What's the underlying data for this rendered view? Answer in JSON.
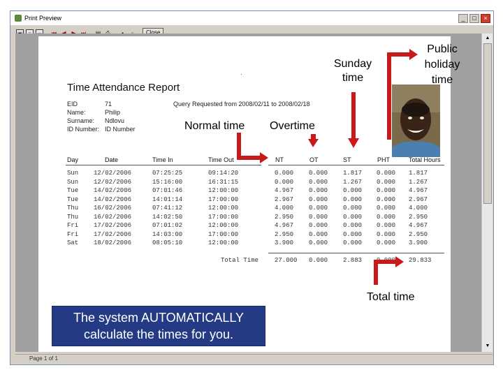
{
  "window": {
    "title": "Print Preview",
    "close_label": "Close",
    "status": "Page 1 of 1"
  },
  "report": {
    "title": "Time Attendance Report",
    "info": [
      {
        "label": "EID",
        "value": "71"
      },
      {
        "label": "Name:",
        "value": "Philip"
      },
      {
        "label": "Surname:",
        "value": "Ndlovu"
      },
      {
        "label": "ID Number:",
        "value": "ID Number"
      }
    ],
    "query": "Query Requested from 2008/02/11 to 2008/02/18",
    "columns": [
      "Day",
      "Date",
      "Time In",
      "Time Out",
      "NT",
      "OT",
      "ST",
      "PHT",
      "Total Hours"
    ],
    "rows": [
      [
        "Sun",
        "12/02/2006",
        "07:25:25",
        "09:14:20",
        "0.000",
        "0.000",
        "1.817",
        "0.000",
        "1.817"
      ],
      [
        "Sun",
        "12/02/2006",
        "15:16:00",
        "16:31:15",
        "0.000",
        "0.000",
        "1.267",
        "0.000",
        "1.267"
      ],
      [
        "Tue",
        "14/02/2006",
        "07:01:46",
        "12:00:00",
        "4.967",
        "0.000",
        "0.000",
        "0.000",
        "4.967"
      ],
      [
        "Tue",
        "14/02/2006",
        "14:01:14",
        "17:00:00",
        "2.967",
        "0.000",
        "0.000",
        "0.000",
        "2.967"
      ],
      [
        "Thu",
        "16/02/2006",
        "07:41:12",
        "12:00:00",
        "4.000",
        "0.000",
        "0.000",
        "0.000",
        "4.000"
      ],
      [
        "Thu",
        "16/02/2006",
        "14:02:50",
        "17:00:00",
        "2.950",
        "0.000",
        "0.000",
        "0.000",
        "2.950"
      ],
      [
        "Fri",
        "17/02/2006",
        "07:01:02",
        "12:00:00",
        "4.967",
        "0.000",
        "0.000",
        "0.000",
        "4.967"
      ],
      [
        "Fri",
        "17/02/2006",
        "14:03:00",
        "17:00:00",
        "2.950",
        "0.000",
        "0.000",
        "0.000",
        "2.950"
      ],
      [
        "Sat",
        "18/02/2006",
        "08:05:10",
        "12:00:00",
        "3.900",
        "0.000",
        "0.000",
        "0.000",
        "3.900"
      ]
    ],
    "total": {
      "label": "Total Time",
      "nt": "27.000",
      "ot": "0.000",
      "st": "2.883",
      "pht": "0.000",
      "hours": "29.833"
    }
  },
  "annotations": {
    "sunday_time": "Sunday time",
    "public_holiday_time": "Public holiday time",
    "normal_time": "Normal time",
    "overtime": "Overtime",
    "total_time": "Total time",
    "callout": "The system AUTOMATICALLY calculate the times for you."
  },
  "colors": {
    "arrow": "#c81a1a",
    "callout_bg": "#253a84",
    "callout_text": "#ffffff"
  }
}
